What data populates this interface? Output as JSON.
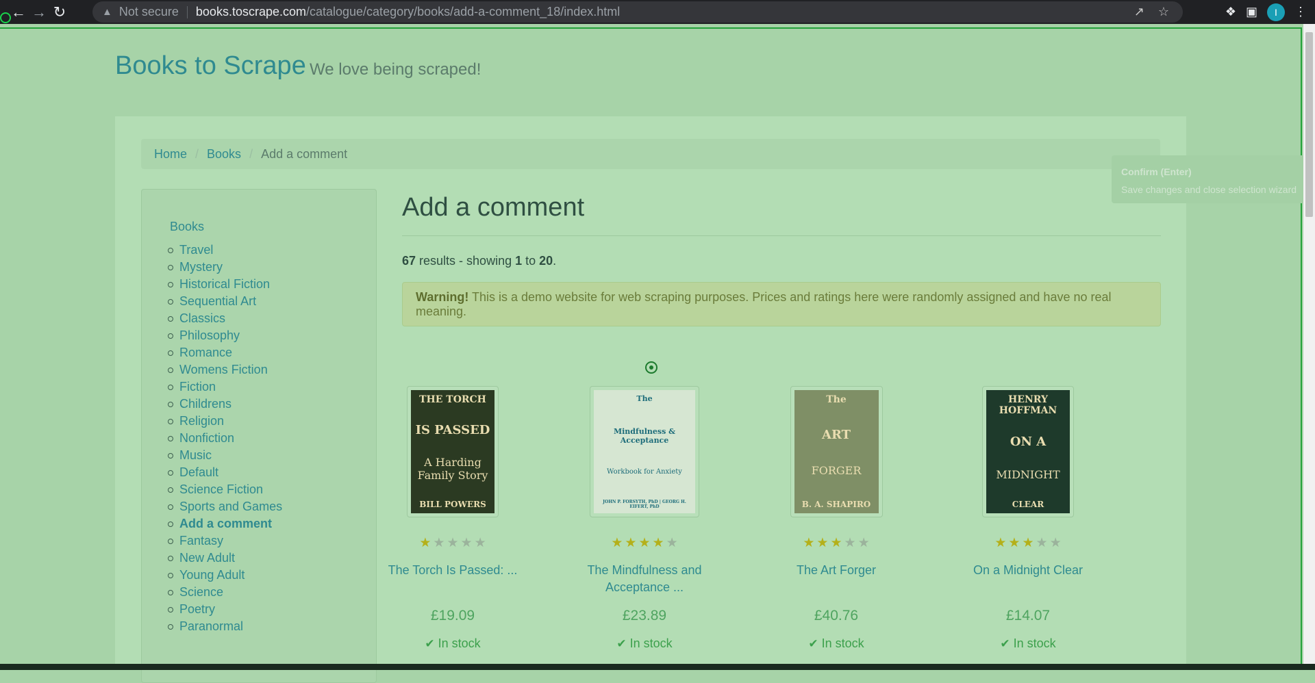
{
  "browser": {
    "security_label": "Not secure",
    "url_host": "books.toscrape.com",
    "url_path": "/catalogue/category/books/add-a-comment_18/index.html",
    "profile_initial": "I"
  },
  "site": {
    "brand": "Books to Scrape",
    "tagline": "We love being scraped!"
  },
  "breadcrumb": {
    "home": "Home",
    "books": "Books",
    "current": "Add a comment"
  },
  "sidebar": {
    "root": "Books",
    "categories": [
      "Travel",
      "Mystery",
      "Historical Fiction",
      "Sequential Art",
      "Classics",
      "Philosophy",
      "Romance",
      "Womens Fiction",
      "Fiction",
      "Childrens",
      "Religion",
      "Nonfiction",
      "Music",
      "Default",
      "Science Fiction",
      "Sports and Games",
      "Add a comment",
      "Fantasy",
      "New Adult",
      "Young Adult",
      "Science",
      "Poetry",
      "Paranormal"
    ],
    "active": "Add a comment"
  },
  "main": {
    "heading": "Add a comment",
    "results_count": "67",
    "results_text_1": " results - showing ",
    "results_from": "1",
    "results_text_2": " to ",
    "results_to": "20",
    "results_text_3": ".",
    "warning_label": "Warning!",
    "warning_text": " This is a demo website for web scraping purposes. Prices and ratings here were randomly assigned and have no real meaning."
  },
  "tooltip": {
    "title": "Confirm (Enter)",
    "text": "Save changes and close selection wizard"
  },
  "products": [
    {
      "title": "The Torch Is Passed: ...",
      "price": "£19.09",
      "rating": 1,
      "stock": "In stock",
      "cover": {
        "line1": "THE TORCH",
        "line2": "IS PASSED",
        "line3": "A Harding Family Story",
        "line4": "BILL POWERS",
        "bg": "#2b3a22"
      }
    },
    {
      "title": "The Mindfulness and Acceptance ...",
      "price": "£23.89",
      "rating": 4,
      "stock": "In stock",
      "cover": {
        "line1": "The",
        "line2": "Mindfulness & Acceptance",
        "line3": "Workbook for Anxiety",
        "line4": "JOHN P. FORSYTH, PhD | GEORG H. EIFERT, PhD",
        "bg": "#d6e6d2"
      }
    },
    {
      "title": "The Art Forger",
      "price": "£40.76",
      "rating": 3,
      "stock": "In stock",
      "cover": {
        "line1": "The",
        "line2": "ART",
        "line3": "FORGER",
        "line4": "B. A. SHAPIRO",
        "bg": "#7f8f66"
      }
    },
    {
      "title": "On a Midnight Clear",
      "price": "£14.07",
      "rating": 3,
      "stock": "In stock",
      "cover": {
        "line1": "HENRY HOFFMAN",
        "line2": "ON A",
        "line3": "MIDNIGHT",
        "line4": "CLEAR",
        "bg": "#1e3a2b"
      }
    }
  ]
}
